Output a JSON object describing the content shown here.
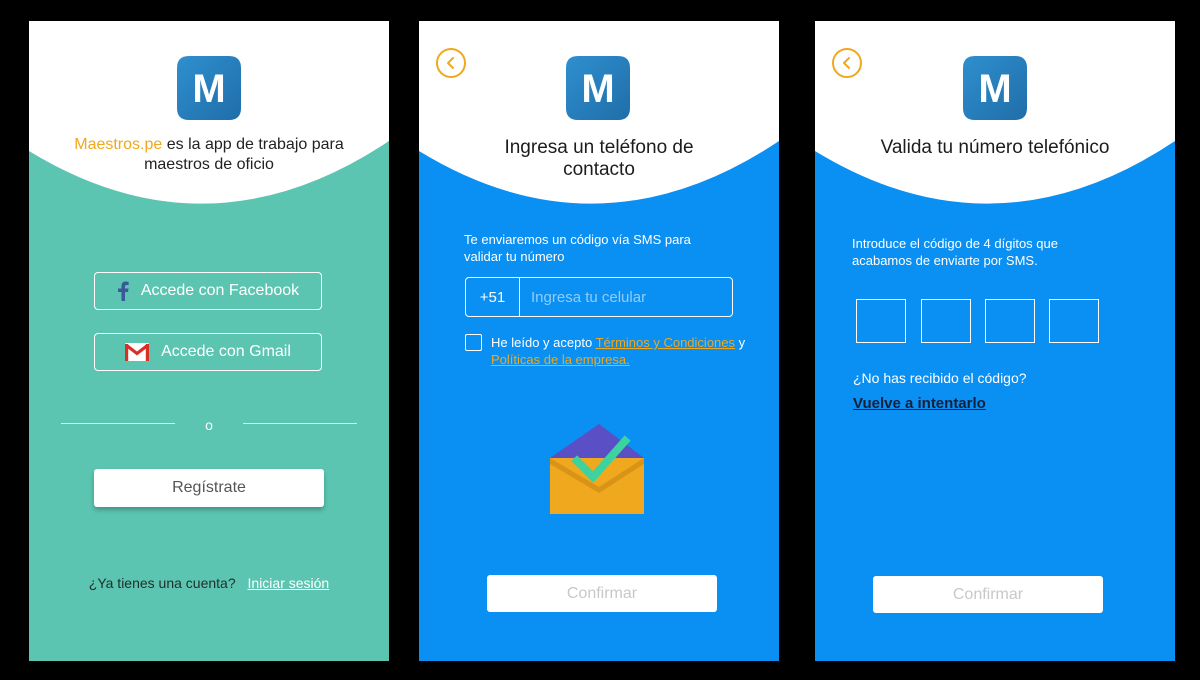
{
  "colors": {
    "teal_bg": "#5bc5b1",
    "blue_bg": "#0a8ff2",
    "accent_orange": "#f0a81e",
    "logo_blue": "#2a82c0"
  },
  "logo": {
    "letter": "M"
  },
  "screen1": {
    "brand": "Maestros.pe",
    "tagline_line1": " es la app de trabajo para",
    "tagline_line2": "maestros de oficio",
    "facebook_button": "Accede con Facebook",
    "gmail_button": "Accede con Gmail",
    "divider": "o",
    "register_button": "Regístrate",
    "has_account": "¿Ya tienes una cuenta?",
    "login_link": "Iniciar sesión"
  },
  "screen2": {
    "title_line1": "Ingresa un teléfono de",
    "title_line2": "contacto",
    "info_line1": "Te enviaremos un código vía SMS para",
    "info_line2": "validar tu número",
    "prefix": "+51",
    "phone_placeholder": "Ingresa tu celular",
    "terms_pre": "He leído y acepto ",
    "terms_link1": "Términos y Condiciones",
    "terms_mid": " y ",
    "terms_link2": "Políticas de la empresa.",
    "confirm_button": "Confirmar"
  },
  "screen3": {
    "title": "Valida tu número telefónico",
    "info_line1": "Introduce el código de 4 dígitos que",
    "info_line2": "acabamos de enviarte por SMS.",
    "code_digits": [
      "",
      "",
      "",
      ""
    ],
    "resend_question": "¿No has recibido el código?",
    "resend_link": "Vuelve a intentarlo",
    "confirm_button": "Confirmar"
  },
  "icons": {
    "back": "chevron-left-icon",
    "facebook": "facebook-icon",
    "gmail": "gmail-icon",
    "envelope": "envelope-check-icon"
  }
}
